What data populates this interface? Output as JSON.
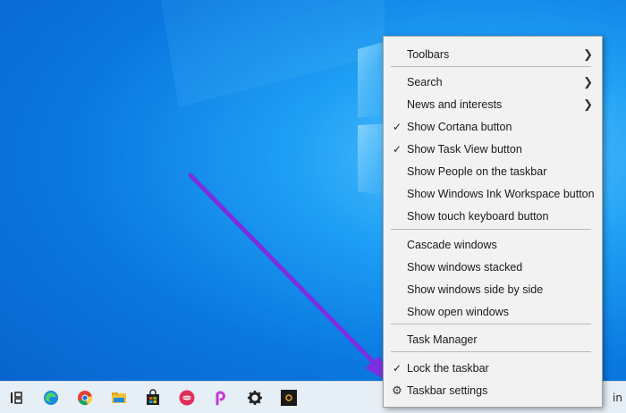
{
  "menu": {
    "items": [
      {
        "label": "Toolbars",
        "checked": false,
        "submenu": true
      },
      {
        "label": "Search",
        "checked": false,
        "submenu": true
      },
      {
        "label": "News and interests",
        "checked": false,
        "submenu": true
      },
      {
        "label": "Show Cortana button",
        "checked": true,
        "submenu": false
      },
      {
        "label": "Show Task View button",
        "checked": true,
        "submenu": false
      },
      {
        "label": "Show People on the taskbar",
        "checked": false,
        "submenu": false
      },
      {
        "label": "Show Windows Ink Workspace button",
        "checked": false,
        "submenu": false
      },
      {
        "label": "Show touch keyboard button",
        "checked": false,
        "submenu": false
      },
      {
        "label": "Cascade windows",
        "checked": false,
        "submenu": false
      },
      {
        "label": "Show windows stacked",
        "checked": false,
        "submenu": false
      },
      {
        "label": "Show windows side by side",
        "checked": false,
        "submenu": false
      },
      {
        "label": "Show open windows",
        "checked": false,
        "submenu": false
      },
      {
        "label": "Task Manager",
        "checked": false,
        "submenu": false
      },
      {
        "label": "Lock the taskbar",
        "checked": true,
        "submenu": false
      },
      {
        "label": "Taskbar settings",
        "checked": false,
        "submenu": false,
        "icon": "gear-icon"
      }
    ],
    "check_glyph": "✓",
    "submenu_glyph": "❯",
    "gear_glyph": "⚙"
  },
  "taskbar": {
    "icons": [
      "task-view-icon",
      "edge-icon",
      "chrome-icon",
      "file-explorer-icon",
      "store-icon",
      "lips-app-icon",
      "picsart-icon",
      "settings-icon",
      "camera-app-icon"
    ],
    "right_text": "in"
  },
  "colors": {
    "desktop_blue": "#0a78e0",
    "arrow_purple": "#7b2fe0",
    "menu_bg": "#f2f2f2"
  }
}
